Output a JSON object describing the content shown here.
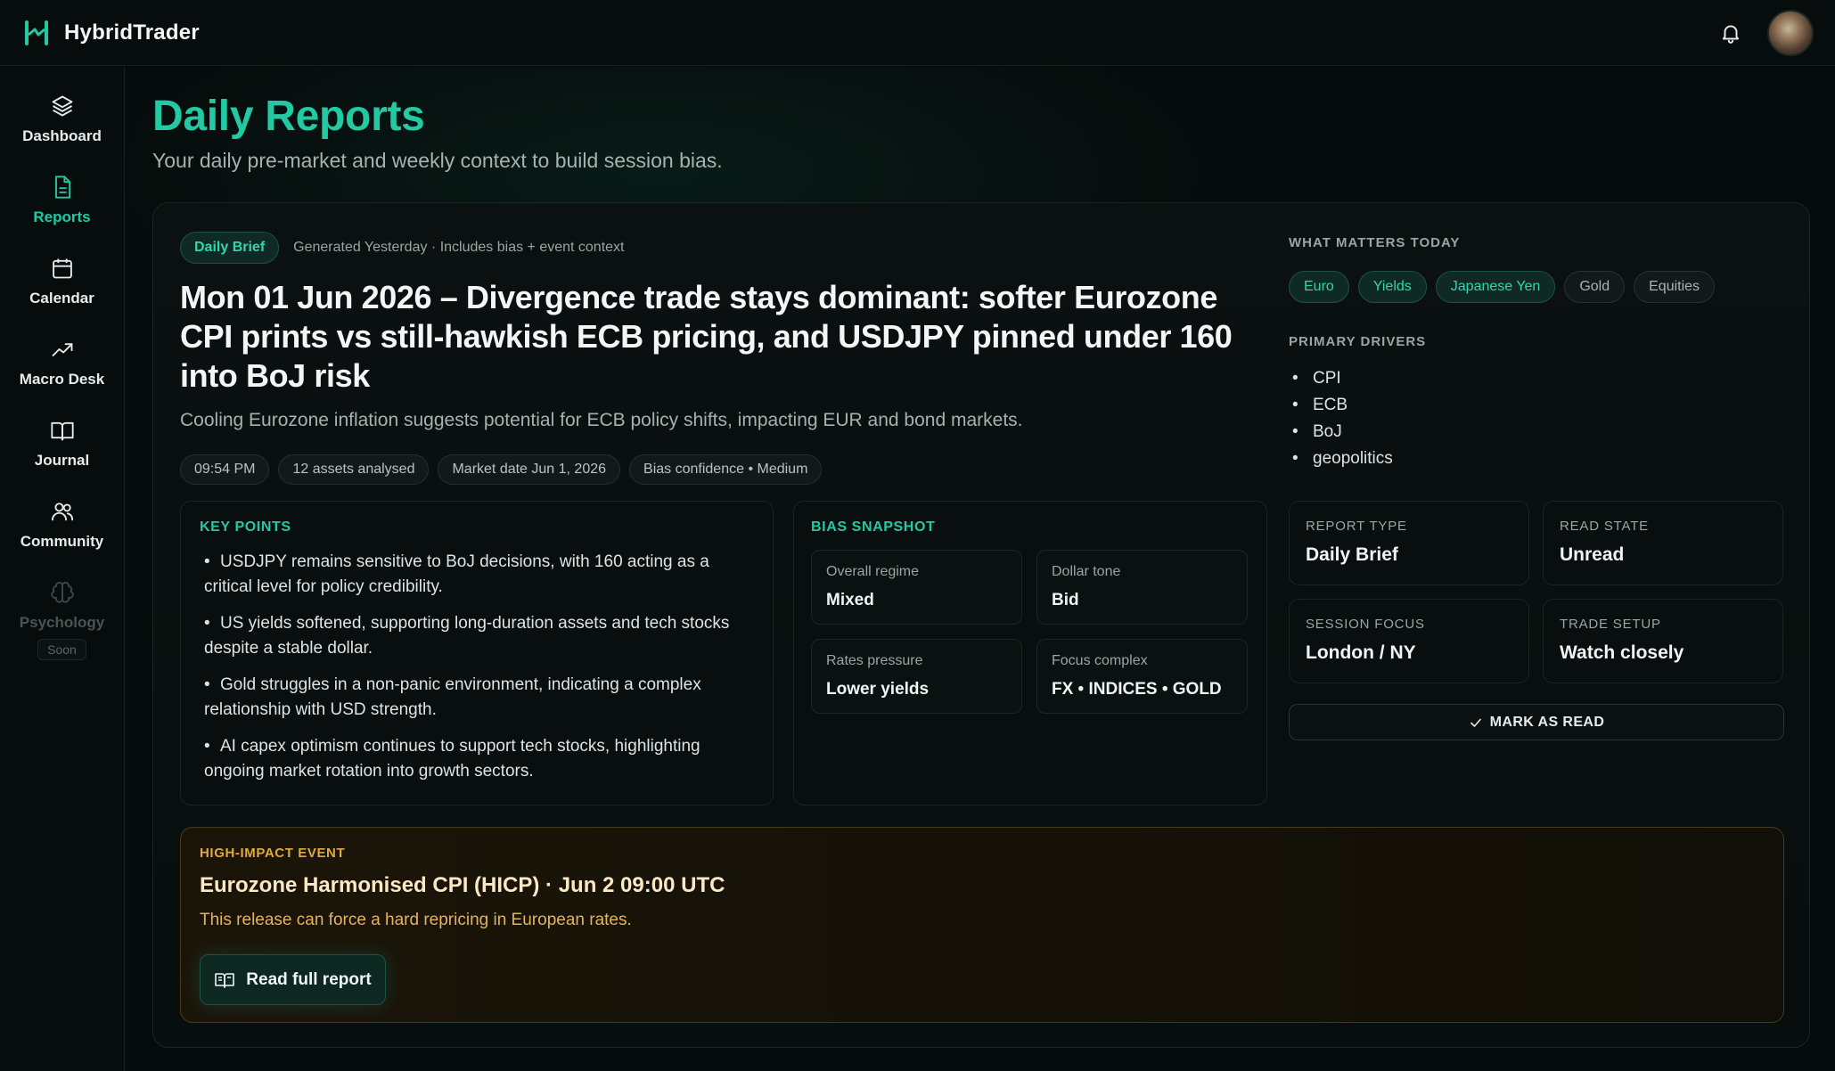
{
  "app": {
    "name": "HybridTrader",
    "accent": "#22c9a2"
  },
  "sidebar": {
    "items": [
      {
        "label": "Dashboard",
        "icon": "layers-icon",
        "active": false
      },
      {
        "label": "Reports",
        "icon": "document-icon",
        "active": true
      },
      {
        "label": "Calendar",
        "icon": "calendar-icon",
        "active": false
      },
      {
        "label": "Macro Desk",
        "icon": "trending-up-icon",
        "active": false
      },
      {
        "label": "Journal",
        "icon": "book-open-icon",
        "active": false
      },
      {
        "label": "Community",
        "icon": "users-icon",
        "active": false
      },
      {
        "label": "Psychology",
        "icon": "brain-icon",
        "active": false,
        "disabled": true,
        "badge": "Soon"
      }
    ]
  },
  "header": {
    "title": "Daily Reports",
    "subtitle": "Your daily pre-market and weekly context to build session bias."
  },
  "report": {
    "type_pill": "Daily Brief",
    "generated": "Generated Yesterday · Includes bias + event context",
    "headline": "Mon 01 Jun 2026 – Divergence trade stays dominant: softer Eurozone CPI prints vs still-hawkish ECB pricing, and USDJPY pinned under 160 into BoJ risk",
    "summary": "Cooling Eurozone inflation suggests potential for ECB policy shifts, impacting EUR and bond markets.",
    "chips": [
      "09:54 PM",
      "12 assets analysed",
      "Market date Jun 1, 2026",
      "Bias confidence • Medium"
    ],
    "key_points": {
      "label": "KEY POINTS",
      "items": [
        "USDJPY remains sensitive to BoJ decisions, with 160 acting as a critical level for policy credibility.",
        "US yields softened, supporting long-duration assets and tech stocks despite a stable dollar.",
        "Gold struggles in a non-panic environment, indicating a complex relationship with USD strength.",
        "AI capex optimism continues to support tech stocks, highlighting ongoing market rotation into growth sectors."
      ]
    },
    "bias_snapshot": {
      "label": "BIAS SNAPSHOT",
      "cells": [
        {
          "label": "Overall regime",
          "value": "Mixed"
        },
        {
          "label": "Dollar tone",
          "value": "Bid"
        },
        {
          "label": "Rates pressure",
          "value": "Lower yields"
        },
        {
          "label": "Focus complex",
          "value": "FX • INDICES • GOLD"
        }
      ]
    }
  },
  "what_matters": {
    "label": "WHAT MATTERS TODAY",
    "tags": [
      {
        "label": "Euro",
        "highlighted": true
      },
      {
        "label": "Yields",
        "highlighted": true
      },
      {
        "label": "Japanese Yen",
        "highlighted": true
      },
      {
        "label": "Gold",
        "highlighted": false
      },
      {
        "label": "Equities",
        "highlighted": false
      }
    ],
    "drivers_label": "PRIMARY DRIVERS",
    "drivers": [
      "CPI",
      "ECB",
      "BoJ",
      "geopolitics"
    ]
  },
  "meta": [
    {
      "label": "REPORT TYPE",
      "value": "Daily Brief"
    },
    {
      "label": "READ STATE",
      "value": "Unread"
    },
    {
      "label": "SESSION FOCUS",
      "value": "London / NY"
    },
    {
      "label": "TRADE SETUP",
      "value": "Watch closely"
    }
  ],
  "mark_read_label": "MARK AS READ",
  "event": {
    "label": "HIGH-IMPACT EVENT",
    "title": "Eurozone Harmonised CPI (HICP) · Jun 2 09:00 UTC",
    "description": "This release can force a hard repricing in European rates.",
    "button_label": "Read full report",
    "accent": "#e0a93a"
  }
}
